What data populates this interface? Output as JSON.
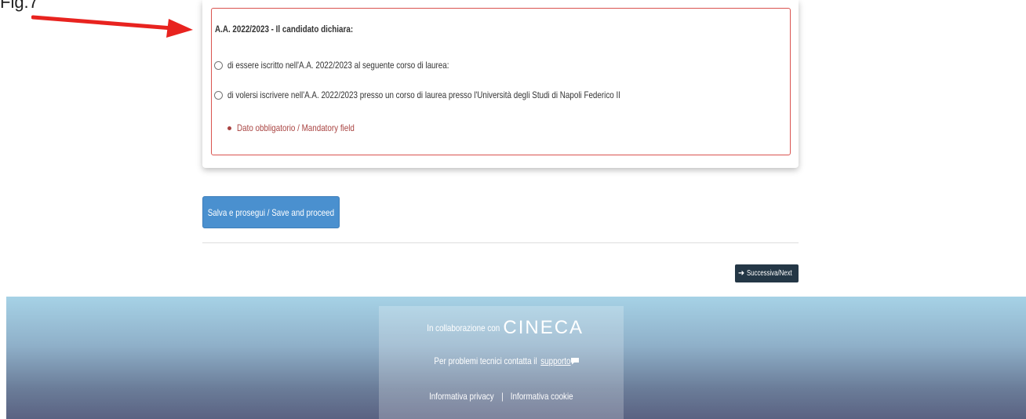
{
  "annotation": {
    "label": "Fig.7",
    "arrow_color": "#e8231f"
  },
  "declaration": {
    "legend": "A.A. 2022/2023 - Il candidato dichiara:",
    "options": [
      {
        "label": "di essere iscritto nell'A.A. 2022/2023 al seguente corso di laurea:",
        "selected": false
      },
      {
        "label": "di volersi iscrivere nell'A.A. 2022/2023 presso un corso di laurea presso l'Università degli Studi di Napoli Federico II",
        "selected": false
      }
    ],
    "error": "Dato obbligatorio / Mandatory field",
    "error_color": "#a94442"
  },
  "actions": {
    "save_label": "Salva e prosegui / Save and proceed",
    "next_label": "Successiva/Next",
    "next_icon": "arrow-right-icon"
  },
  "footer": {
    "collab_text": "In collaborazione con",
    "logo_text": "CINECA",
    "support_text": "Per problemi tecnici contatta il",
    "support_link": "supporto",
    "support_icon": "chat-bubble-icon",
    "privacy_link": "Informativa privacy",
    "separator": "|",
    "cookie_link": "Informativa cookie"
  },
  "colors": {
    "primary_button": "#4a90cf",
    "next_button": "#243746",
    "error_border": "#d9534f"
  }
}
